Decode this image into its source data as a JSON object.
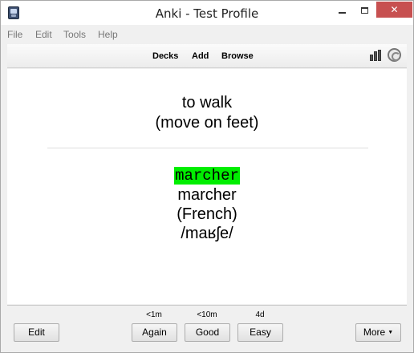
{
  "window": {
    "title": "Anki - Test Profile",
    "controls": {
      "minimize_icon": "minimize-icon",
      "maximize_icon": "maximize-icon",
      "close_icon": "close-icon",
      "close_glyph": "✕"
    }
  },
  "menu": [
    "File",
    "Edit",
    "Tools",
    "Help"
  ],
  "toolbar": {
    "links": [
      "Decks",
      "Add",
      "Browse"
    ],
    "icons": [
      "stats-icon",
      "sync-icon"
    ]
  },
  "card": {
    "question": [
      "to walk",
      "(move on feet)"
    ],
    "typed_answer": "marcher",
    "typed_answer_color": "#00ee00",
    "answer": [
      "marcher",
      "(French)",
      "/maʁʃe/"
    ]
  },
  "bottom": {
    "edit_label": "Edit",
    "answers": [
      {
        "due": "<1m",
        "label": "Again"
      },
      {
        "due": "<10m",
        "label": "Good"
      },
      {
        "due": "4d",
        "label": "Easy"
      }
    ],
    "more_label": "More",
    "more_caret": "▼"
  }
}
